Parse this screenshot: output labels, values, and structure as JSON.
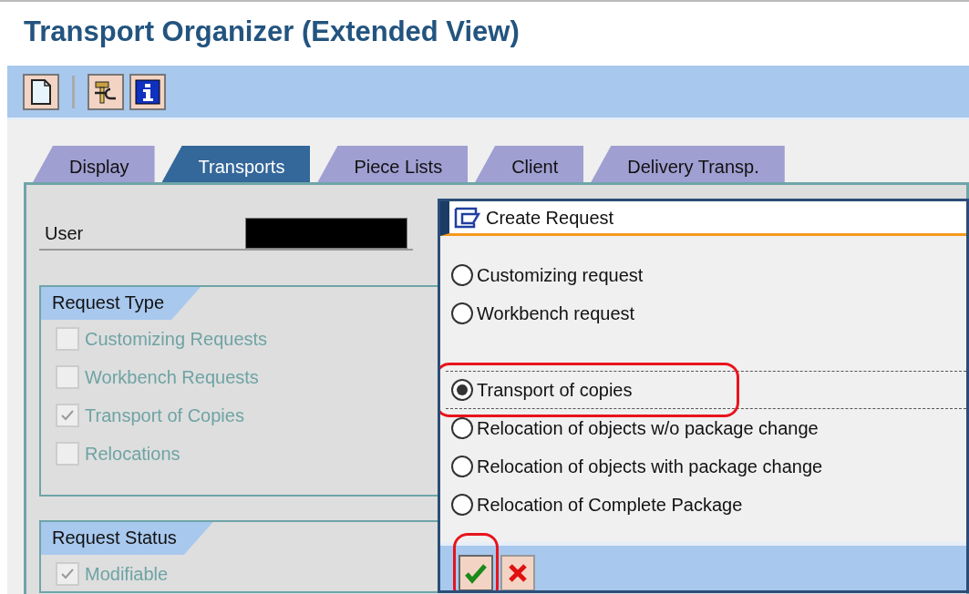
{
  "window": {
    "title": "Transport Organizer (Extended View)"
  },
  "toolbar": [
    {
      "kind": "new"
    },
    {
      "kind": "separator"
    },
    {
      "kind": "tools"
    },
    {
      "kind": "info"
    }
  ],
  "tabs": [
    {
      "label": "Display",
      "selected": false
    },
    {
      "label": "Transports",
      "selected": true
    },
    {
      "label": "Piece Lists",
      "selected": false
    },
    {
      "label": "Client",
      "selected": false
    },
    {
      "label": "Delivery Transp.",
      "selected": false
    }
  ],
  "user": {
    "label": "User",
    "redacted": true
  },
  "request_type": {
    "title": "Request Type",
    "items": [
      {
        "label": "Customizing Requests",
        "checked": false,
        "disabled": true
      },
      {
        "label": "Workbench Requests",
        "checked": false,
        "disabled": true
      },
      {
        "label": "Transport of Copies",
        "checked": true,
        "disabled": true
      },
      {
        "label": "Relocations",
        "checked": false,
        "disabled": true
      }
    ]
  },
  "request_status": {
    "title": "Request Status",
    "items": [
      {
        "label": "Modifiable",
        "checked": true,
        "disabled": true
      }
    ]
  },
  "dialog": {
    "title": "Create Request",
    "options": [
      {
        "label": "Customizing request",
        "selected": false,
        "highlighted": false
      },
      {
        "label": "Workbench request",
        "selected": false,
        "highlighted": false
      },
      {
        "label": "Transport of copies",
        "selected": true,
        "highlighted": true
      },
      {
        "label": "Relocation of objects w/o package change",
        "selected": false,
        "highlighted": false
      },
      {
        "label": "Relocation of objects with package change",
        "selected": false,
        "highlighted": false
      },
      {
        "label": "Relocation of Complete Package",
        "selected": false,
        "highlighted": false
      }
    ],
    "buttons": [
      {
        "kind": "confirm",
        "highlighted": true
      },
      {
        "kind": "cancel",
        "highlighted": false
      }
    ]
  }
}
